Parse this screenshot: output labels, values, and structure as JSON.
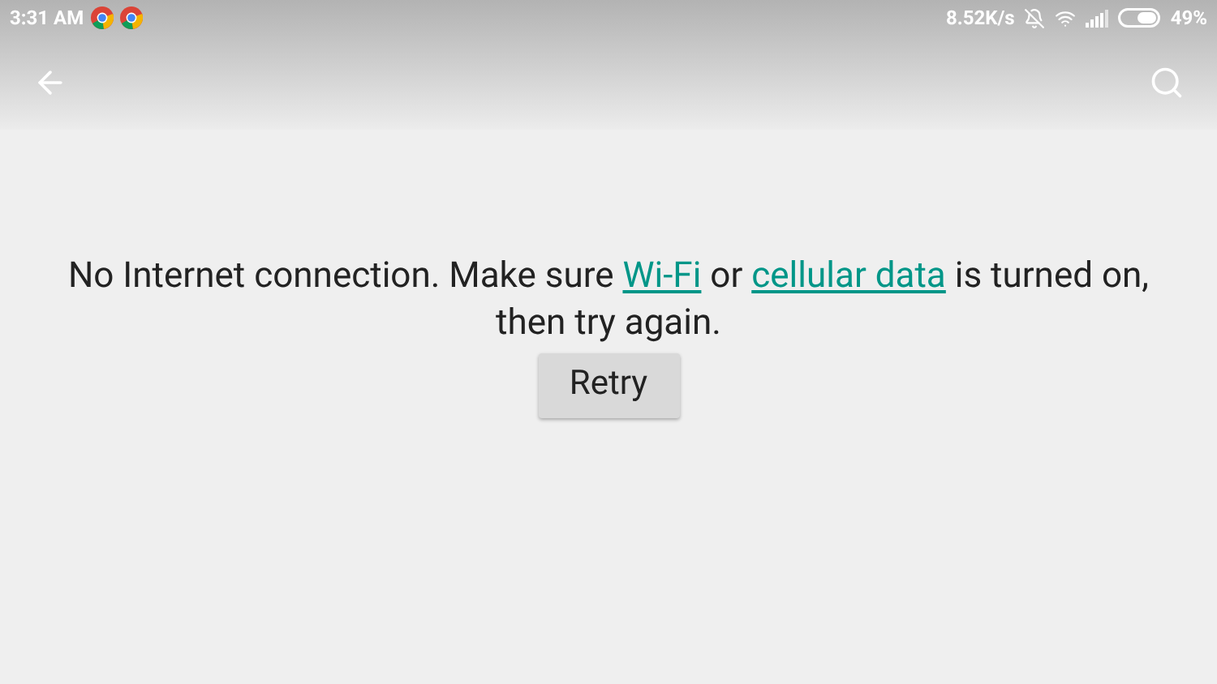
{
  "status_bar": {
    "time": "3:31 AM",
    "speed": "8.52K/s",
    "battery": "49%"
  },
  "message": [
    {
      "kind": "text",
      "text": "No Internet connection. Make sure "
    },
    {
      "kind": "link",
      "text": "Wi-Fi"
    },
    {
      "kind": "text",
      "text": " or "
    },
    {
      "kind": "link",
      "text": "cellular data"
    },
    {
      "kind": "text",
      "text": " is turned on, then try again."
    }
  ],
  "button": "Retry"
}
